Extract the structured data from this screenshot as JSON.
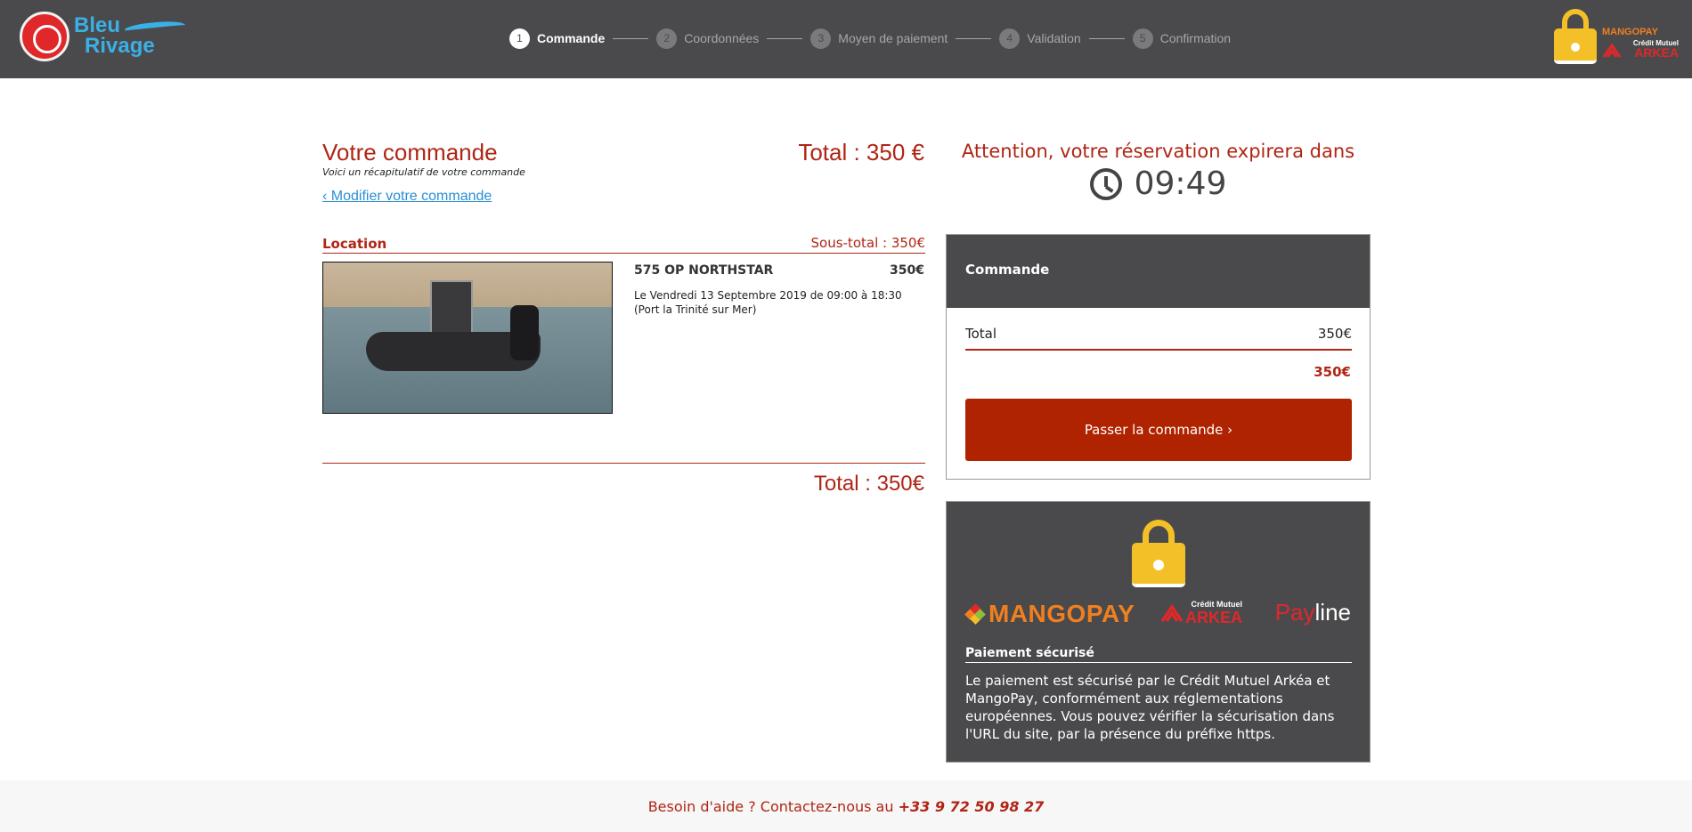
{
  "brand": {
    "line1": "Bleu",
    "line2": "Rivage"
  },
  "steps": [
    {
      "num": "1",
      "label": "Commande",
      "active": true
    },
    {
      "num": "2",
      "label": "Coordonnées",
      "active": false
    },
    {
      "num": "3",
      "label": "Moyen de paiement",
      "active": false
    },
    {
      "num": "4",
      "label": "Validation",
      "active": false
    },
    {
      "num": "5",
      "label": "Confirmation",
      "active": false
    }
  ],
  "header_secure": {
    "mangopay": "MANGOPAY",
    "cm_line1": "Crédit Mutuel",
    "cm_line2": "ARKEA"
  },
  "order": {
    "title": "Votre commande",
    "subtitle": "Voici un récapitulatif de votre commande",
    "modify_link": "‹ Modifier votre commande",
    "total_top": "Total : 350 €",
    "section_title": "Location",
    "section_subtotal": "Sous-total : 350€",
    "item_name": "575 OP NORTHSTAR",
    "item_price": "350€",
    "item_desc": "Le Vendredi 13 Septembre 2019 de 09:00 à 18:30 (Port la Trinité sur Mer)",
    "total_bottom": "Total : 350€"
  },
  "timer": {
    "title": "Attention, votre réservation expirera dans",
    "value": "09:49"
  },
  "summary": {
    "header": "Commande",
    "total_label": "Total",
    "total_value": "350€",
    "grand_total": "350€",
    "button": "Passer la commande ›"
  },
  "secure": {
    "mangopay": "MANGOPAY",
    "cm_line1": "Crédit Mutuel",
    "cm_line2": "ARKEA",
    "payline_a": "Pay",
    "payline_b": "line",
    "title": "Paiement sécurisé",
    "text": "Le paiement est sécurisé par le Crédit Mutuel Arkéa et MangoPay, conformément aux réglementations européennes. Vous pouvez vérifier la sécurisation dans l'URL du site, par la présence du préfixe https."
  },
  "footer": {
    "text": "Besoin d'aide ? Contactez-nous au ",
    "phone": "+33 9 72 50 98 27"
  },
  "colors": {
    "header_bg": "#4a4a4c",
    "accent_red": "#b02515",
    "button_red": "#b02300",
    "lock_yellow": "#f4c028",
    "mangopay_orange": "#f07f20",
    "link_blue": "#2a8fd4"
  }
}
